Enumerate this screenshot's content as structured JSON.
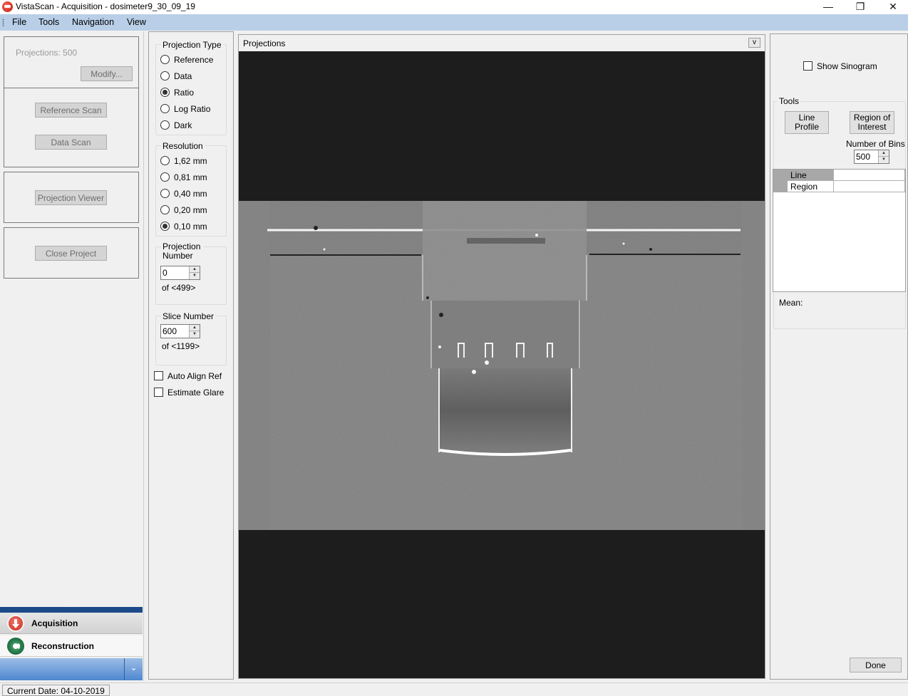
{
  "window": {
    "title": "VistaScan - Acquisition - dosimeter9_30_09_19",
    "minimize_glyph": "—",
    "restore_glyph": "❐",
    "close_glyph": "✕"
  },
  "menu": [
    "File",
    "Tools",
    "Navigation",
    "View"
  ],
  "left_panel": {
    "projections_label": "Projections: 500",
    "modify_button": "Modify...",
    "reference_scan_button": "Reference Scan",
    "data_scan_button": "Data Scan",
    "projection_viewer_button": "Projection Viewer",
    "close_project_button": "Close Project"
  },
  "controls": {
    "projection_type": {
      "title": "Projection Type",
      "options": [
        "Reference",
        "Data",
        "Ratio",
        "Log Ratio",
        "Dark"
      ],
      "selected": "Ratio"
    },
    "resolution": {
      "title": "Resolution",
      "options": [
        "1,62 mm",
        "0,81 mm",
        "0,40 mm",
        "0,20 mm",
        "0,10 mm"
      ],
      "selected": "0,10 mm"
    },
    "projection_number": {
      "title": "Projection Number",
      "value": "0",
      "of_label": "of <499>"
    },
    "slice_number": {
      "title": "Slice Number",
      "value": "600",
      "of_label": "of <1199>"
    },
    "auto_align_ref": {
      "label": "Auto Align Ref",
      "checked": false
    },
    "estimate_glare": {
      "label": "Estimate Glare",
      "checked": false
    }
  },
  "projections_panel": {
    "title": "Projections",
    "dropdown_glyph": "v"
  },
  "right_panel": {
    "show_sinogram": {
      "label": "Show Sinogram",
      "checked": false
    },
    "tools_title": "Tools",
    "line_profile_button": "Line Profile",
    "region_of_interest_button": "Region of Interest",
    "number_of_bins_label": "Number of Bins",
    "number_of_bins_value": "500",
    "table_rows": [
      "Line",
      "Region"
    ],
    "mean_label": "Mean:",
    "done_button": "Done"
  },
  "navigation": {
    "grip_glyph": "·····",
    "items": [
      {
        "label": "Acquisition",
        "icon": "acquisition-download-icon",
        "color": "#d63a2a"
      },
      {
        "label": "Reconstruction",
        "icon": "reconstruction-refresh-icon",
        "color": "#2e8b57"
      }
    ],
    "overflow_glyph": "⌄"
  },
  "status": {
    "current_date": "Current Date: 04-10-2019"
  }
}
